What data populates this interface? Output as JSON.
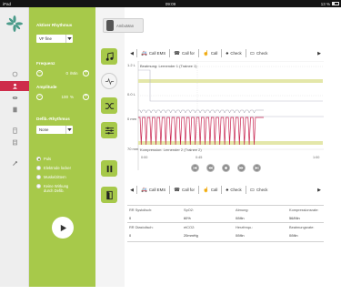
{
  "statusbar": {
    "carrier": "iPad",
    "time": "09:09",
    "battery": "13 %"
  },
  "nav": {
    "items": [
      {
        "name": "home-icon"
      },
      {
        "name": "user-icon"
      },
      {
        "name": "eye-icon"
      },
      {
        "name": "book-icon"
      },
      {
        "name": "document-icon"
      },
      {
        "name": "list-icon"
      },
      {
        "name": "wrench-icon"
      }
    ]
  },
  "panel": {
    "rhythm_label": "Aktiver Rhythmus",
    "rhythm_value": "VF fine",
    "frequency_label": "Frequenz",
    "frequency_value": "0",
    "frequency_unit": "/Min",
    "amplitude_label": "Amplitude",
    "amplitude_value": "100",
    "amplitude_unit": "%",
    "defib_label": "Defib.-Rhythmus",
    "defib_value": "None",
    "radios": [
      {
        "label": "Puls",
        "checked": true
      },
      {
        "label": "Elektrode locker",
        "checked": false
      },
      {
        "label": "Muskelzittern",
        "checked": false
      },
      {
        "label": "Keine Wirkung durch Defib.",
        "checked": false
      }
    ]
  },
  "tools": {
    "ambu_label": "AmbuMan",
    "buttons": [
      "music-icon",
      "pulse-icon",
      "shuffle-icon",
      "sliders-icon",
      "pause-icon",
      "door-icon"
    ]
  },
  "actions": [
    {
      "label": "Call EMS",
      "icon": "ambulance-icon"
    },
    {
      "label": "Call for",
      "icon": "phone-icon"
    },
    {
      "label": "Call",
      "icon": "hand-icon"
    },
    {
      "label": "Check",
      "icon": "lungs-icon"
    },
    {
      "label": "Check",
      "icon": "monitor-icon"
    }
  ],
  "graph": {
    "top_left": "1.2 L",
    "mid_left": "0.0 L",
    "lower_left": "0 mm",
    "bottom_left": "70 mm",
    "vent_label": "Beatmung: Lernender 1 (Trainee 1)",
    "comp_label": "Kompression: Lernender 2 (Trainee 2)",
    "time_ticks": [
      "0:00",
      "0:45",
      "1:00"
    ]
  },
  "vitals": {
    "row1": [
      {
        "label": "RR Systolisch:",
        "value": "0"
      },
      {
        "label": "SpO2:",
        "value": "60%"
      },
      {
        "label": "Atmung:",
        "value": "0/Min"
      },
      {
        "label": "Kompressionsrate:",
        "value": "56/Min"
      }
    ],
    "row2": [
      {
        "label": "RR Diastolisch:",
        "value": "0"
      },
      {
        "label": "etCO2:",
        "value": "20mmHg"
      },
      {
        "label": "Herzfrequ.:",
        "value": "0/Min"
      },
      {
        "label": "Beatmungsrate:",
        "value": "0/Min"
      }
    ]
  },
  "colors": {
    "accent": "#a7c94a",
    "active_nav": "#ce2c4a",
    "wave": "#c8234f",
    "band": "#e4e7a9"
  }
}
